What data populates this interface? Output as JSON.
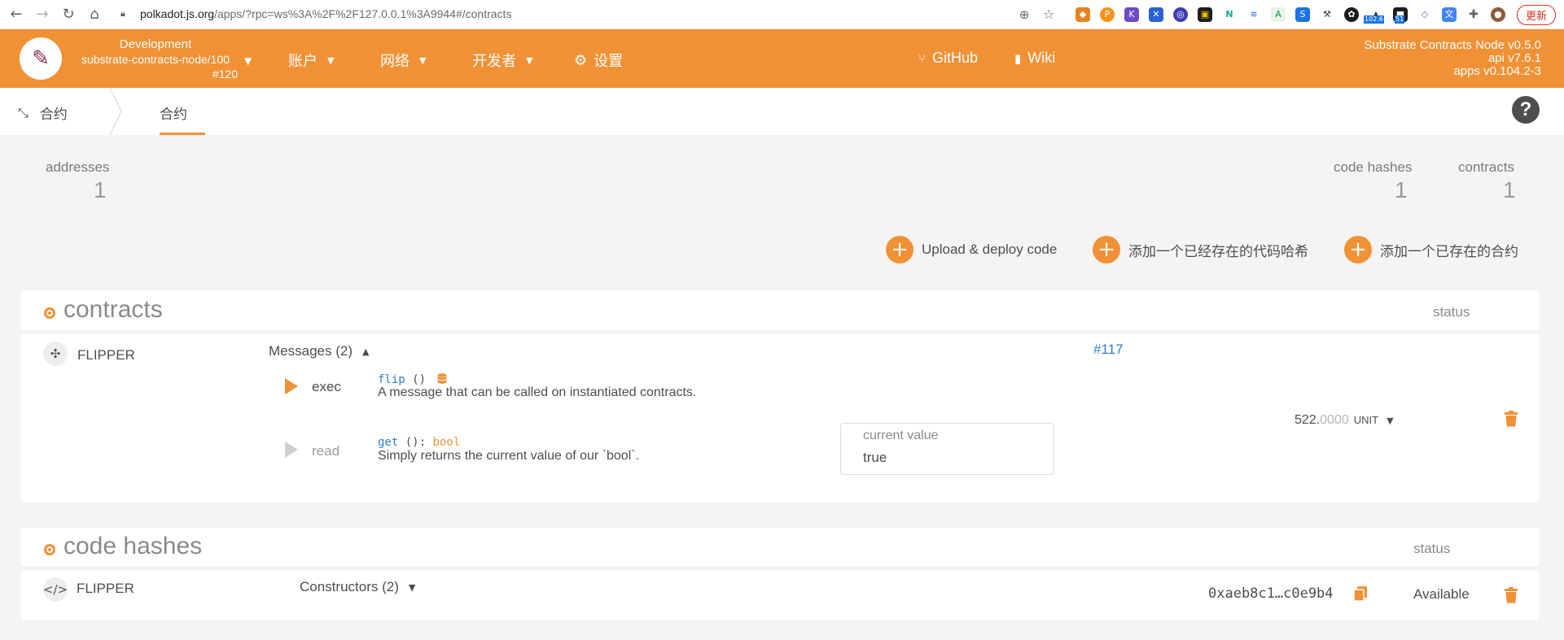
{
  "browser": {
    "url_host": "polkadot.js.org",
    "url_path": "/apps/?rpc=ws%3A%2F%2F127.0.0.1%3A9944#/contracts",
    "update_label": "更新",
    "badge_a": "102.6",
    "badge_b": "51"
  },
  "header": {
    "chain_type": "Development",
    "chain_name": "substrate-contracts-node/100",
    "chain_block": "#120",
    "menu_accounts": "账户",
    "menu_network": "网络",
    "menu_developer": "开发者",
    "menu_settings": "设置",
    "link_github": "GitHub",
    "link_wiki": "Wiki",
    "node_name": "Substrate Contracts Node v0.5.0",
    "api_version": "api v7.6.1",
    "apps_version": "apps v0.104.2-3",
    "brand_color": "#f19135"
  },
  "subnav": {
    "root_label": "合约",
    "active_tab": "合约",
    "help": "?"
  },
  "summary": {
    "addresses_label": "addresses",
    "addresses_value": "1",
    "code_hashes_label": "code hashes",
    "code_hashes_value": "1",
    "contracts_label": "contracts",
    "contracts_value": "1"
  },
  "actions": {
    "upload_deploy": "Upload & deploy code",
    "add_code_hash": "添加一个已经存在的代码哈希",
    "add_contract": "添加一个已存在的合约"
  },
  "contracts": {
    "title": "contracts",
    "status_header": "status",
    "item": {
      "name": "FLIPPER",
      "messages_label": "Messages (2)",
      "block": "#117",
      "balance_int": "522.",
      "balance_dec": "0000",
      "balance_unit": "UNIT",
      "messages": [
        {
          "type": "exec",
          "fn": "flip",
          "args": " ()",
          "doc": "A message that can be called on instantiated contracts."
        },
        {
          "type": "read",
          "fn": "get",
          "args": " (): ",
          "ret": "bool",
          "doc": "Simply returns the current value of our `bool`."
        }
      ],
      "current_value_label": "current value",
      "current_value": "true"
    }
  },
  "code_hashes": {
    "title": "code hashes",
    "status_header": "status",
    "item": {
      "name": "FLIPPER",
      "constructors_label": "Constructors (2)",
      "hash": "0xaeb8c1…c0e9b4",
      "status": "Available"
    }
  }
}
